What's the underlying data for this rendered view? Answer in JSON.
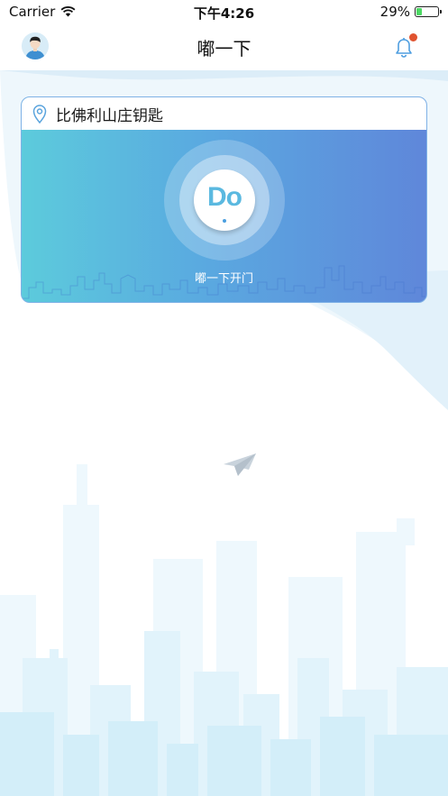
{
  "status_bar": {
    "carrier": "Carrier",
    "time": "下午4:26",
    "battery_text": "29%",
    "battery_level": 0.29
  },
  "nav": {
    "title": "嘟一下"
  },
  "card": {
    "title": "比佛利山庄钥匙",
    "logo_text": "Do",
    "action_label": "嘟一下开门"
  },
  "colors": {
    "card_gradient_start": "#5ccbdc",
    "card_gradient_end": "#5f87da",
    "notification_dot": "#e0532f",
    "battery_fill": "#4cd964"
  },
  "icons": {
    "wifi": "wifi-icon",
    "avatar": "user-avatar",
    "bell": "bell-icon",
    "location": "location-pin-icon",
    "plane": "airplane-icon"
  }
}
